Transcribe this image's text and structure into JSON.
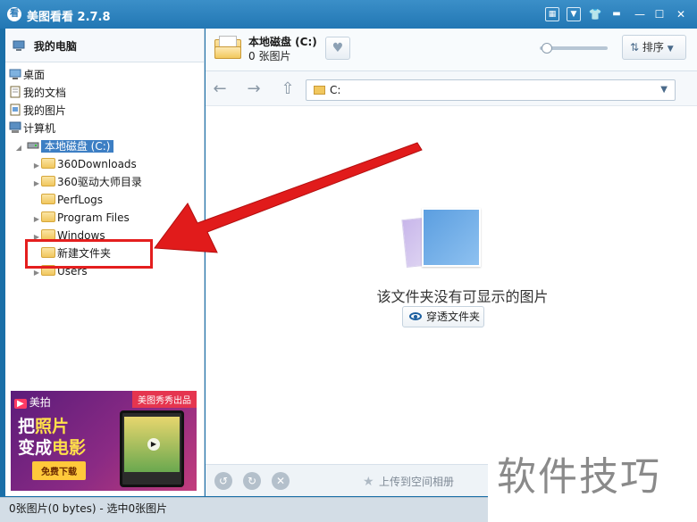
{
  "app": {
    "title": "美图看看 2.7.8",
    "logo_char": "看"
  },
  "titlebar": {
    "icons": [
      "menu-square-icon",
      "dropdown-box-icon",
      "skin-shirt-icon",
      "minimize-icon",
      "maximize-icon",
      "close-icon"
    ]
  },
  "sidebar": {
    "header": "我的电脑",
    "items": [
      {
        "label": "桌面",
        "icon": "desktop-icon"
      },
      {
        "label": "我的文档",
        "icon": "documents-icon"
      },
      {
        "label": "我的图片",
        "icon": "pictures-icon"
      },
      {
        "label": "计算机",
        "icon": "computer-icon"
      }
    ],
    "drive": "本地磁盘 (C:)",
    "folders": [
      "360Downloads",
      "360驱动大师目录",
      "PerfLogs",
      "Program Files",
      "Windows",
      "新建文件夹",
      "Users"
    ]
  },
  "ad": {
    "brand": "美拍",
    "brand_badge": "▶",
    "corner": "美图秀秀出品",
    "headline_line1_a": "把",
    "headline_line1_b": "照片",
    "headline_line2_a": "变成",
    "headline_line2_b": "电影",
    "download": "免费下载"
  },
  "header": {
    "drive_title": "本地磁盘 (C:)",
    "count": "0 张图片",
    "sort_label": "排序"
  },
  "nav": {
    "address": "C:"
  },
  "content": {
    "empty_message": "该文件夹没有可显示的图片",
    "browse_button": "穿透文件夹"
  },
  "bottom": {
    "upload_label": "上传到空间相册"
  },
  "status": {
    "text": "0张图片(0 bytes) - 选中0张图片"
  },
  "watermark": {
    "text": "软件技巧"
  },
  "colors": {
    "title_bar": "#2a7cb9",
    "highlight_box": "#e41e1e",
    "selection": "#3d7fc4"
  }
}
